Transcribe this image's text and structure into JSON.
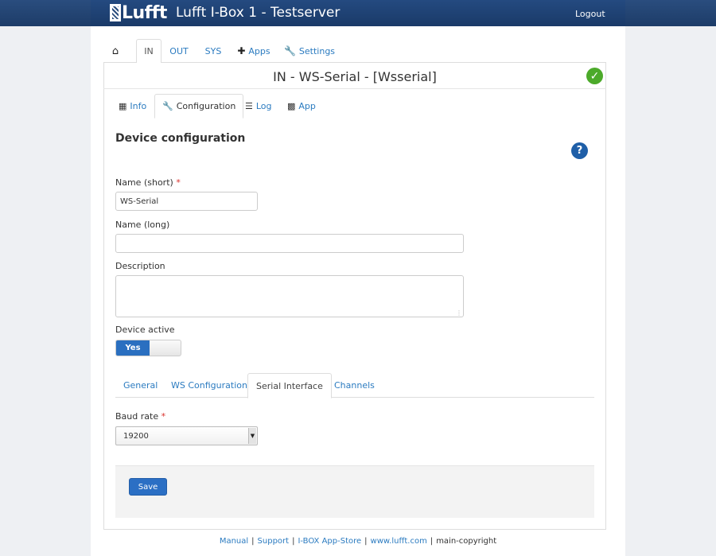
{
  "header": {
    "logo_text": "Lufft",
    "title": "Lufft I-Box 1 - Testserver",
    "logout": "Logout"
  },
  "topnav": {
    "home_icon": "home-icon",
    "items": [
      {
        "label": "IN",
        "active": true
      },
      {
        "label": "OUT"
      },
      {
        "label": "SYS"
      },
      {
        "label": "Apps",
        "icon": "plus-icon"
      },
      {
        "label": "Settings",
        "icon": "wrench-icon"
      }
    ]
  },
  "panel": {
    "title": "IN - WS-Serial - [Wsserial]",
    "status_icon": "check-circle-icon"
  },
  "subtabs": [
    {
      "label": "Info",
      "icon": "grid-icon"
    },
    {
      "label": "Configuration",
      "icon": "wrench-icon",
      "active": true
    },
    {
      "label": "Log",
      "icon": "list-icon"
    },
    {
      "label": "App",
      "icon": "apps-icon"
    }
  ],
  "form": {
    "section_title": "Device configuration",
    "help_icon": "?",
    "name_short_label": "Name (short)",
    "required_mark": "*",
    "name_short_value": "WS-Serial",
    "name_long_label": "Name (long)",
    "name_long_value": "",
    "description_label": "Description",
    "description_value": "",
    "device_active_label": "Device active",
    "device_active_value": "Yes"
  },
  "lower_tabs": [
    {
      "label": "General"
    },
    {
      "label": "WS Configuration"
    },
    {
      "label": "Serial Interface",
      "active": true
    },
    {
      "label": "Channels"
    }
  ],
  "serial": {
    "baud_label": "Baud rate",
    "baud_value": "19200"
  },
  "actions": {
    "save": "Save"
  },
  "footer": {
    "links": [
      "Manual",
      "Support",
      "I-BOX App-Store",
      "www.lufft.com"
    ],
    "copyright": "main-copyright"
  }
}
